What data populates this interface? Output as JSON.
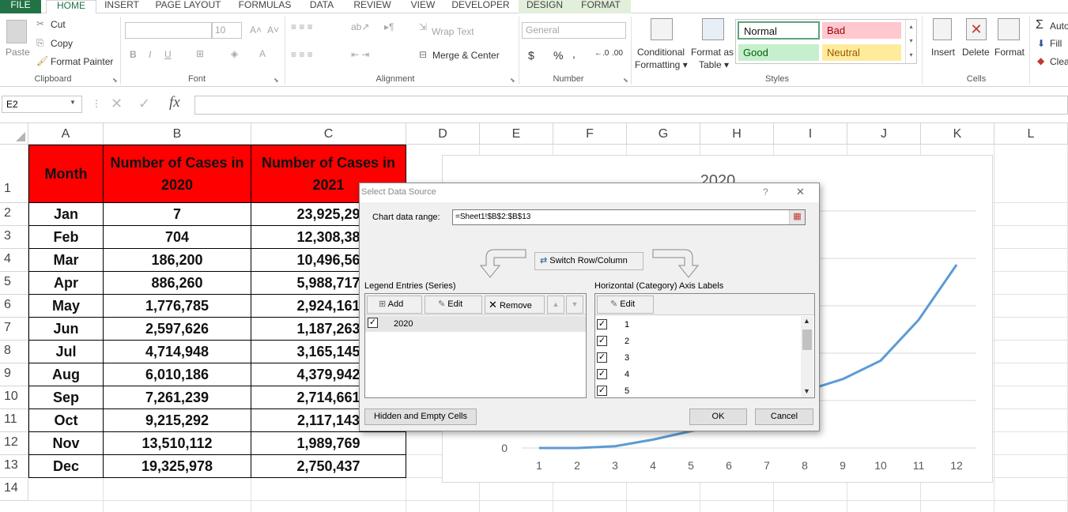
{
  "tabs": [
    "FILE",
    "HOME",
    "INSERT",
    "PAGE LAYOUT",
    "FORMULAS",
    "DATA",
    "REVIEW",
    "VIEW",
    "DEVELOPER",
    "DESIGN",
    "FORMAT"
  ],
  "clipboard": {
    "paste": "Paste",
    "cut": "Cut",
    "copy": "Copy",
    "format_painter": "Format Painter",
    "label": "Clipboard"
  },
  "font": {
    "size": "10",
    "bold": "B",
    "italic": "I",
    "underline": "U",
    "label": "Font",
    "grow": "A˄",
    "shrink": "A˅"
  },
  "alignment": {
    "wrap": "Wrap Text",
    "merge": "Merge & Center",
    "label": "Alignment"
  },
  "number": {
    "format": "General",
    "currency": "$",
    "percent": "%",
    "comma": ",",
    "label": "Number"
  },
  "styles": {
    "conditional": "Conditional",
    "formatting": "Formatting",
    "format_as": "Format as",
    "table": "Table",
    "normal": "Normal",
    "bad": "Bad",
    "good": "Good",
    "neutral": "Neutral",
    "label": "Styles"
  },
  "cells": {
    "insert": "Insert",
    "delete": "Delete",
    "format": "Format",
    "label": "Cells"
  },
  "editing": {
    "autosum": "Auto",
    "fill": "Fill",
    "clear": "Clea"
  },
  "formula_bar": {
    "name_box": "E2",
    "fx": "fx",
    "value": ""
  },
  "colors": {
    "accent": "#217346",
    "header_fill": "#ff0000",
    "series": "#5b9bd5"
  },
  "columns": [
    "A",
    "B",
    "C",
    "D",
    "E",
    "F",
    "G",
    "H",
    "I",
    "J",
    "K",
    "L"
  ],
  "rows": [
    "1",
    "2",
    "3",
    "4",
    "5",
    "6",
    "7",
    "8",
    "9",
    "10",
    "11",
    "12",
    "13",
    "14"
  ],
  "table": {
    "headers": [
      "Month",
      "Number of Cases in 2020",
      "Number of Cases in 2021"
    ],
    "data": [
      [
        "Jan",
        "7",
        "23,925,29"
      ],
      [
        "Feb",
        "704",
        "12,308,38"
      ],
      [
        "Mar",
        "186,200",
        "10,496,56"
      ],
      [
        "Apr",
        "886,260",
        "5,988,717"
      ],
      [
        "May",
        "1,776,785",
        "2,924,161"
      ],
      [
        "Jun",
        "2,597,626",
        "1,187,263"
      ],
      [
        "Jul",
        "4,714,948",
        "3,165,145"
      ],
      [
        "Aug",
        "6,010,186",
        "4,379,942"
      ],
      [
        "Sep",
        "7,261,239",
        "2,714,661"
      ],
      [
        "Oct",
        "9,215,292",
        "2,117,143"
      ],
      [
        "Nov",
        "13,510,112",
        "1,989,769"
      ],
      [
        "Dec",
        "19,325,978",
        "2,750,437"
      ]
    ]
  },
  "chart_data": {
    "type": "line",
    "title": "2020",
    "x": [
      1,
      2,
      3,
      4,
      5,
      6,
      7,
      8,
      9,
      10,
      11,
      12
    ],
    "series": [
      {
        "name": "2020",
        "values": [
          7,
          704,
          186200,
          886260,
          1776785,
          2597626,
          4714948,
          6010186,
          7261239,
          9215292,
          13510112,
          19325978
        ]
      }
    ],
    "ylim": [
      0,
      25000000
    ],
    "y_tick_visible": "0",
    "grid": true
  },
  "dialog": {
    "title": "Select Data Source",
    "help": "?",
    "close": "✕",
    "range_label": "Chart data range:",
    "range_value": "=Sheet1!$B$2:$B$13",
    "switch": "Switch Row/Column",
    "legend_label": "Legend Entries (Series)",
    "add": "Add",
    "edit": "Edit",
    "remove": "Remove",
    "series": [
      "2020"
    ],
    "axis_label": "Horizontal (Category) Axis Labels",
    "axis_edit": "Edit",
    "axis_items": [
      "1",
      "2",
      "3",
      "4",
      "5"
    ],
    "hidden": "Hidden and Empty Cells",
    "ok": "OK",
    "cancel": "Cancel"
  }
}
